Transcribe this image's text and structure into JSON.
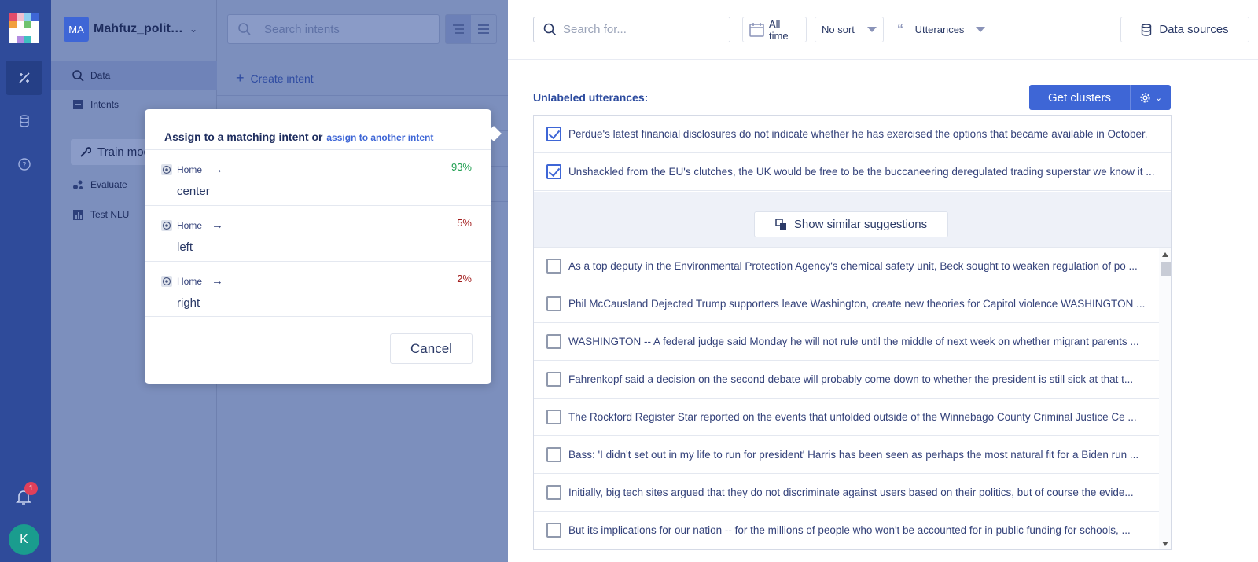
{
  "colors": {
    "rail": "#2f4b9a",
    "accent": "#3e66d6",
    "good": "#1e9e4f",
    "bad": "#a31e1e"
  },
  "rail": {
    "icons": [
      "logo",
      "training-icon",
      "database-icon",
      "help-icon",
      "bell-icon"
    ],
    "notification_count": "1",
    "avatar_initial": "K"
  },
  "sidebar": {
    "project_badge": "MA",
    "project_name": "Mahfuz_politics",
    "items": [
      {
        "label": "Data",
        "icon": "search-icon"
      },
      {
        "label": "Intents",
        "icon": "intents-icon"
      },
      {
        "label": "Train model",
        "icon": "wrench-icon"
      },
      {
        "label": "Evaluate",
        "icon": "evaluate-icon"
      },
      {
        "label": "Test NLU",
        "icon": "chart-icon"
      }
    ]
  },
  "intents": {
    "search_placeholder": "Search intents",
    "create_label": "Create intent"
  },
  "toolbar": {
    "search_placeholder": "Search for...",
    "time_filter": "All time",
    "sort": "No sort",
    "view": "Utterances",
    "data_sources": "Data sources"
  },
  "main": {
    "unlabeled_title": "Unlabeled utterances:",
    "get_clusters": "Get clusters",
    "show_similar": "Show similar suggestions",
    "selected_utterances": [
      "Perdue's latest financial disclosures do not indicate whether he has exercised the options that became available in October.",
      "Unshackled from the EU's clutches, the UK would be free to be the buccaneering deregulated trading superstar we know it ..."
    ],
    "utterances": [
      "As a top deputy in the Environmental Protection Agency's chemical safety unit, Beck sought to weaken regulation of po ...",
      "Phil McCausland Dejected Trump supporters leave Washington, create new theories for Capitol violence WASHINGTON ...",
      "WASHINGTON -- A federal judge said Monday he will not rule until the middle of next week on whether migrant parents  ...",
      "Fahrenkopf said a decision on the second debate will probably come down to whether the president is still sick at that t...",
      "The Rockford Register Star reported on the events that unfolded outside of the Winnebago County Criminal Justice Ce  ...",
      "Bass: 'I didn't set out in my life to run for president' Harris has been seen as perhaps the most natural fit for a Biden run ...",
      "Initially, big tech sites argued that they do not discriminate against users based on their politics, but of course the evide...",
      "But its implications for our nation -- for the millions of people who won't be accounted for in public funding for schools, ..."
    ]
  },
  "modal": {
    "title": "Assign to a matching intent or",
    "link": "assign to another intent",
    "options": [
      {
        "path": "Home",
        "arrow": "→",
        "name": "center",
        "pct": "93%"
      },
      {
        "path": "Home",
        "arrow": "→",
        "name": "left",
        "pct": "5%"
      },
      {
        "path": "Home",
        "arrow": "→",
        "name": "right",
        "pct": "2%"
      }
    ],
    "cancel": "Cancel"
  }
}
